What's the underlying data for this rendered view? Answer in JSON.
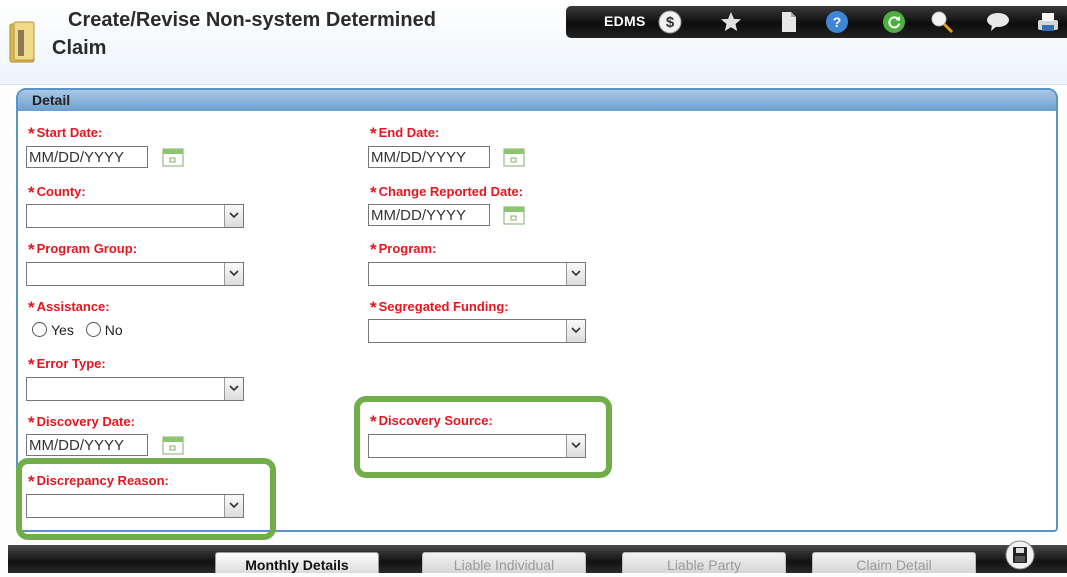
{
  "header": {
    "title_line1": "Create/Revise Non-system Determined",
    "title_line2": "Claim",
    "toolbar": {
      "edms_label": "EDMS",
      "icons": [
        "dollar-icon",
        "star-icon",
        "document-icon",
        "help-icon",
        "refresh-icon",
        "search-icon",
        "chat-icon",
        "print-icon"
      ]
    }
  },
  "panel": {
    "title": "Detail",
    "fields": {
      "start_date": {
        "label": "Start Date:",
        "value": "MM/DD/YYYY"
      },
      "end_date": {
        "label": "End Date:",
        "value": "MM/DD/YYYY"
      },
      "county": {
        "label": "County:"
      },
      "change_reported_date": {
        "label": "Change Reported Date:",
        "value": "MM/DD/YYYY"
      },
      "program_group": {
        "label": "Program Group:"
      },
      "program": {
        "label": "Program:"
      },
      "assistance": {
        "label": "Assistance:",
        "yes": "Yes",
        "no": "No"
      },
      "segregated_funding": {
        "label": "Segregated Funding:"
      },
      "error_type": {
        "label": "Error Type:"
      },
      "discovery_date": {
        "label": "Discovery Date:",
        "value": "MM/DD/YYYY"
      },
      "discovery_source": {
        "label": "Discovery Source:"
      },
      "discrepancy_reason": {
        "label": "Discrepancy Reason:"
      }
    },
    "required_marker": "*"
  },
  "tabs": [
    {
      "label": "Monthly Details",
      "state": "active"
    },
    {
      "label": "Liable Individual",
      "state": "disabled"
    },
    {
      "label": "Liable Party",
      "state": "disabled"
    },
    {
      "label": "Claim Detail",
      "state": "disabled"
    }
  ],
  "colors": {
    "required_label": "#e8141e",
    "panel_border": "#5c93c7",
    "highlight": "#72ad4c",
    "toolbar": "#111111"
  }
}
